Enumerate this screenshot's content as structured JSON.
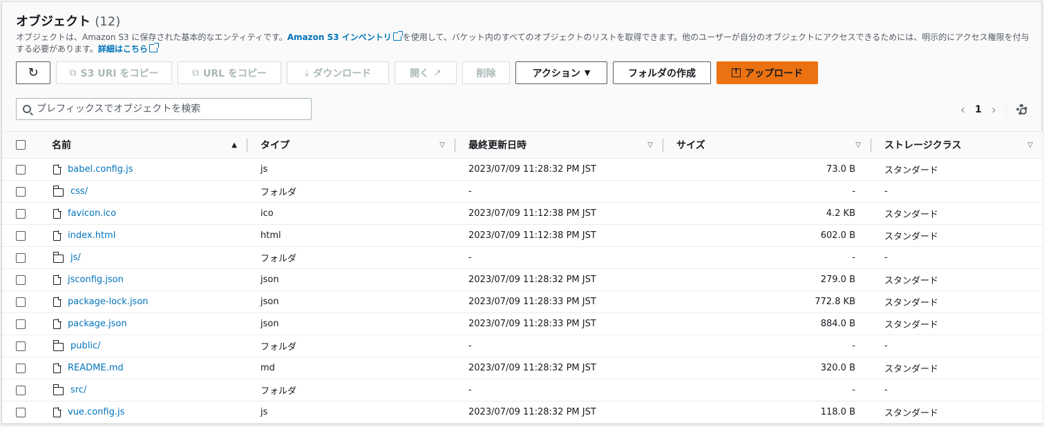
{
  "header": {
    "title": "オブジェクト",
    "count": "(12)",
    "desc_1": "オブジェクトは、Amazon S3 に保存された基本的なエンティティです。",
    "desc_link_1": "Amazon S3 インベントリ",
    "desc_2": "を使用して、バケット内のすべてのオブジェクトのリストを取得できます。他のユーザーが自分のオブジェクトにアクセスできるためには、明示的にアクセス権限を付与する必要があります。",
    "desc_link_2": "詳細はこちら"
  },
  "toolbar": {
    "copy_s3_uri": "S3 URI をコピー",
    "copy_url": "URL をコピー",
    "download": "ダウンロード",
    "open": "開く",
    "delete": "削除",
    "actions": "アクション",
    "create_folder": "フォルダの作成",
    "upload": "アップロード"
  },
  "search": {
    "placeholder": "プレフィックスでオブジェクトを検索"
  },
  "pager": {
    "page": "1"
  },
  "table": {
    "columns": [
      "名前",
      "タイプ",
      "最終更新日時",
      "サイズ",
      "ストレージクラス"
    ],
    "rows": [
      {
        "name": "babel.config.js",
        "kind": "file",
        "type": "js",
        "modified": "2023/07/09 11:28:32 PM JST",
        "size": "73.0 B",
        "storage": "スタンダード"
      },
      {
        "name": "css/",
        "kind": "folder",
        "type": "フォルダ",
        "modified": "-",
        "size": "-",
        "storage": "-"
      },
      {
        "name": "favicon.ico",
        "kind": "file",
        "type": "ico",
        "modified": "2023/07/09 11:12:38 PM JST",
        "size": "4.2 KB",
        "storage": "スタンダード"
      },
      {
        "name": "index.html",
        "kind": "file",
        "type": "html",
        "modified": "2023/07/09 11:12:38 PM JST",
        "size": "602.0 B",
        "storage": "スタンダード"
      },
      {
        "name": "js/",
        "kind": "folder",
        "type": "フォルダ",
        "modified": "-",
        "size": "-",
        "storage": "-"
      },
      {
        "name": "jsconfig.json",
        "kind": "file",
        "type": "json",
        "modified": "2023/07/09 11:28:32 PM JST",
        "size": "279.0 B",
        "storage": "スタンダード"
      },
      {
        "name": "package-lock.json",
        "kind": "file",
        "type": "json",
        "modified": "2023/07/09 11:28:33 PM JST",
        "size": "772.8 KB",
        "storage": "スタンダード"
      },
      {
        "name": "package.json",
        "kind": "file",
        "type": "json",
        "modified": "2023/07/09 11:28:33 PM JST",
        "size": "884.0 B",
        "storage": "スタンダード"
      },
      {
        "name": "public/",
        "kind": "folder",
        "type": "フォルダ",
        "modified": "-",
        "size": "-",
        "storage": "-"
      },
      {
        "name": "README.md",
        "kind": "file",
        "type": "md",
        "modified": "2023/07/09 11:28:32 PM JST",
        "size": "320.0 B",
        "storage": "スタンダード"
      },
      {
        "name": "src/",
        "kind": "folder",
        "type": "フォルダ",
        "modified": "-",
        "size": "-",
        "storage": "-"
      },
      {
        "name": "vue.config.js",
        "kind": "file",
        "type": "js",
        "modified": "2023/07/09 11:28:32 PM JST",
        "size": "118.0 B",
        "storage": "スタンダード"
      }
    ]
  }
}
